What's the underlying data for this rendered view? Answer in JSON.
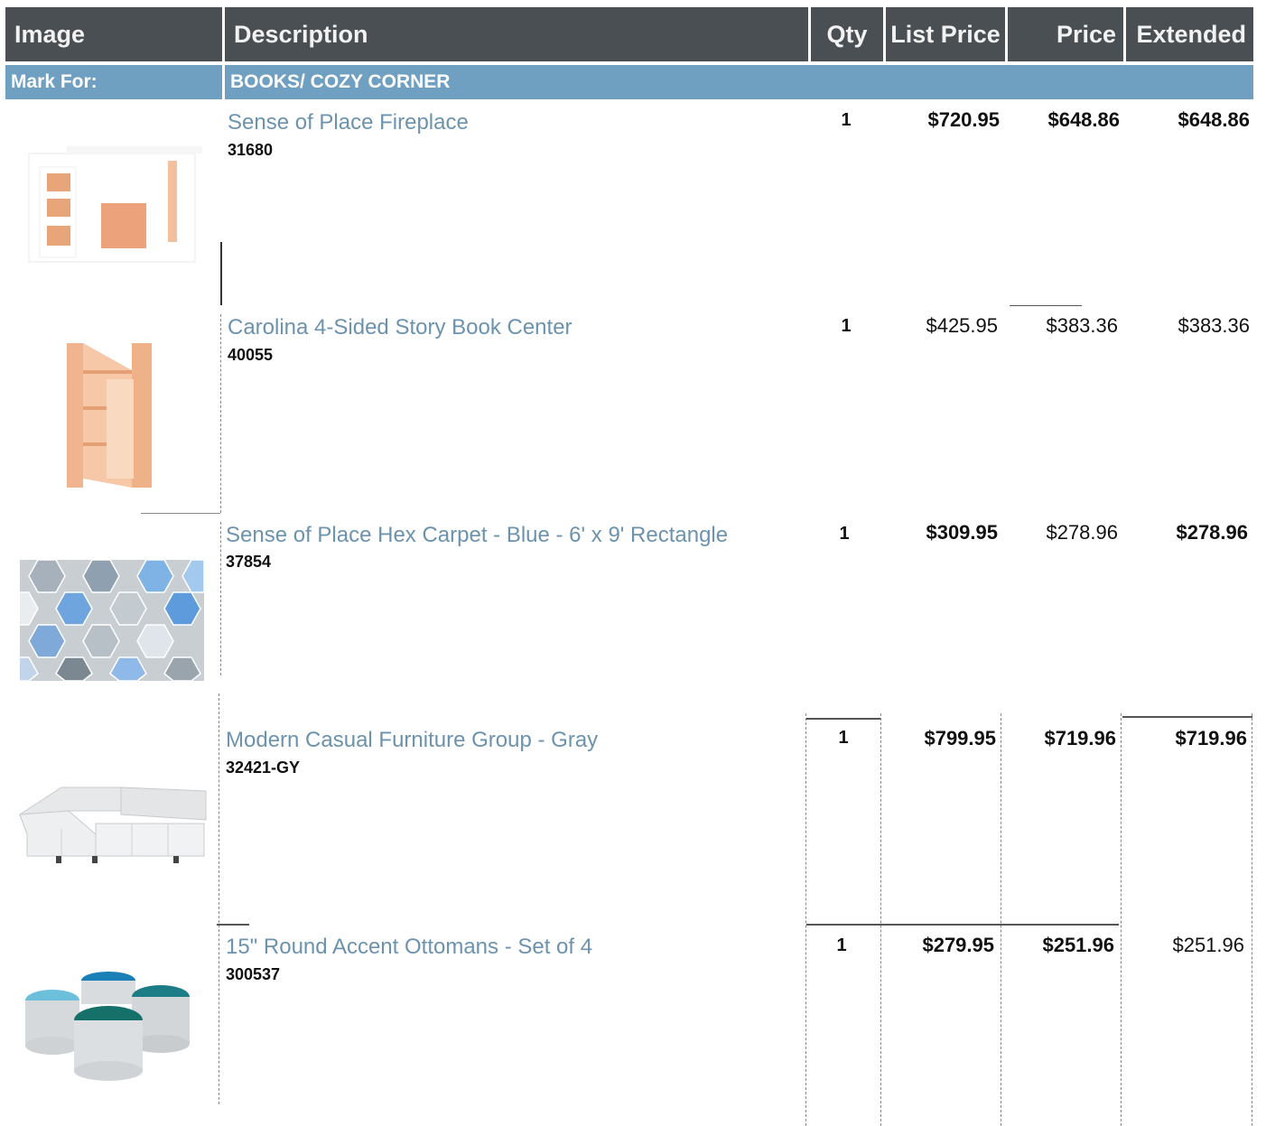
{
  "table": {
    "headers": {
      "image": "Image",
      "description": "Description",
      "qty": "Qty",
      "list_price": "List Price",
      "price": "Price",
      "extended": "Extended"
    },
    "mark_for": {
      "label": "Mark For:",
      "value": "BOOKS/ COZY CORNER"
    },
    "rows": [
      {
        "name": "Sense of Place Fireplace",
        "sku": "31680",
        "qty": "1",
        "list_price": "$720.95",
        "price": "$648.86",
        "extended": "$648.86",
        "image_icon": "fireplace-icon"
      },
      {
        "name": "Carolina 4-Sided Story Book Center",
        "sku": "40055",
        "qty": "1",
        "list_price": "$425.95",
        "price": "$383.36",
        "extended": "$383.36",
        "image_icon": "bookshelf-icon"
      },
      {
        "name": "Sense of Place Hex Carpet - Blue - 6' x 9' Rectangle",
        "sku": "37854",
        "qty": "1",
        "list_price": "$309.95",
        "price": "$278.96",
        "extended": "$278.96",
        "image_icon": "carpet-icon"
      },
      {
        "name": "Modern Casual Furniture Group - Gray",
        "sku": "32421-GY",
        "qty": "1",
        "list_price": "$799.95",
        "price": "$719.96",
        "extended": "$719.96",
        "image_icon": "sofa-icon"
      },
      {
        "name": "15\" Round Accent Ottomans - Set of 4",
        "sku": "300537",
        "qty": "1",
        "list_price": "$279.95",
        "price": "$251.96",
        "extended": "$251.96",
        "image_icon": "ottomans-icon"
      }
    ]
  },
  "colors": {
    "header_bg": "#4a4f53",
    "mark_for_bg": "#6f9fc1",
    "product_name": "#6c93ad"
  }
}
